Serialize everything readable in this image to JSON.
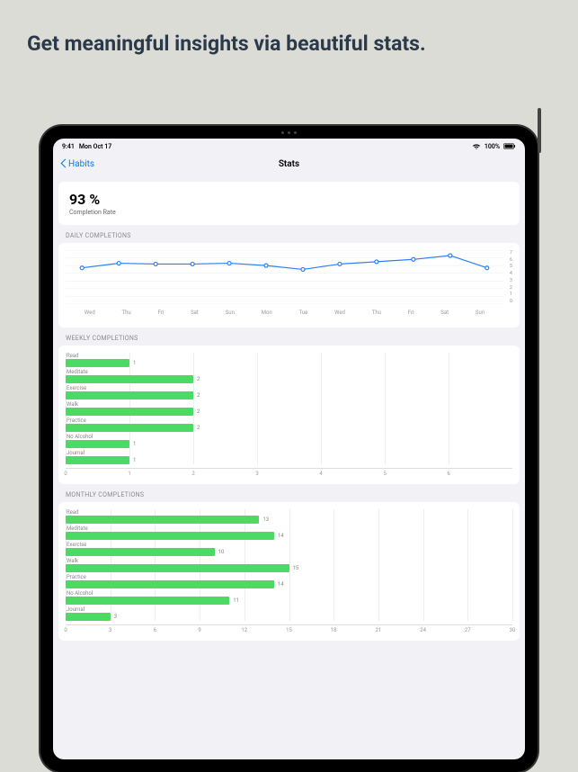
{
  "headline": "Get meaningful insights via beautiful stats.",
  "status": {
    "time": "9:41",
    "date": "Mon Oct 17",
    "battery": "100%"
  },
  "nav": {
    "back": "Habits",
    "title": "Stats"
  },
  "summary": {
    "value": "93 %",
    "label": "Completion Rate"
  },
  "sections": {
    "daily": "DAILY COMPLETIONS",
    "weekly": "WEEKLY COMPLETIONS",
    "monthly": "MONTHLY COMPLETIONS"
  },
  "chart_data": [
    {
      "type": "line",
      "title": "DAILY COMPLETIONS",
      "categories": [
        "Wed",
        "Thu",
        "Fri",
        "Sat",
        "Sun",
        "Mon",
        "Tue",
        "Wed",
        "Thu",
        "Fri",
        "Sat",
        "Sun"
      ],
      "values": [
        4.7,
        5.3,
        5.2,
        5.2,
        5.3,
        5.0,
        4.5,
        5.2,
        5.5,
        5.8,
        6.3,
        4.7
      ],
      "ylim": [
        0,
        7
      ],
      "yticks": [
        0,
        1,
        2,
        3,
        4,
        5,
        6,
        7
      ]
    },
    {
      "type": "bar",
      "title": "WEEKLY COMPLETIONS",
      "orientation": "horizontal",
      "categories": [
        "Read",
        "Meditate",
        "Exercise",
        "Walk",
        "Practice",
        "No Alcohol",
        "Journal"
      ],
      "values": [
        1,
        2,
        2,
        2,
        2,
        1,
        1
      ],
      "xlim": [
        0,
        7
      ],
      "xticks": [
        0,
        1,
        2,
        3,
        4,
        5,
        6
      ]
    },
    {
      "type": "bar",
      "title": "MONTHLY COMPLETIONS",
      "orientation": "horizontal",
      "categories": [
        "Read",
        "Meditate",
        "Exercise",
        "Walk",
        "Practice",
        "No Alcohol",
        "Journal"
      ],
      "values": [
        13,
        14,
        10,
        15,
        14,
        11,
        3
      ],
      "xlim": [
        0,
        30
      ],
      "xticks": [
        0,
        3,
        6,
        9,
        12,
        15,
        18,
        21,
        24,
        27,
        30
      ]
    }
  ]
}
